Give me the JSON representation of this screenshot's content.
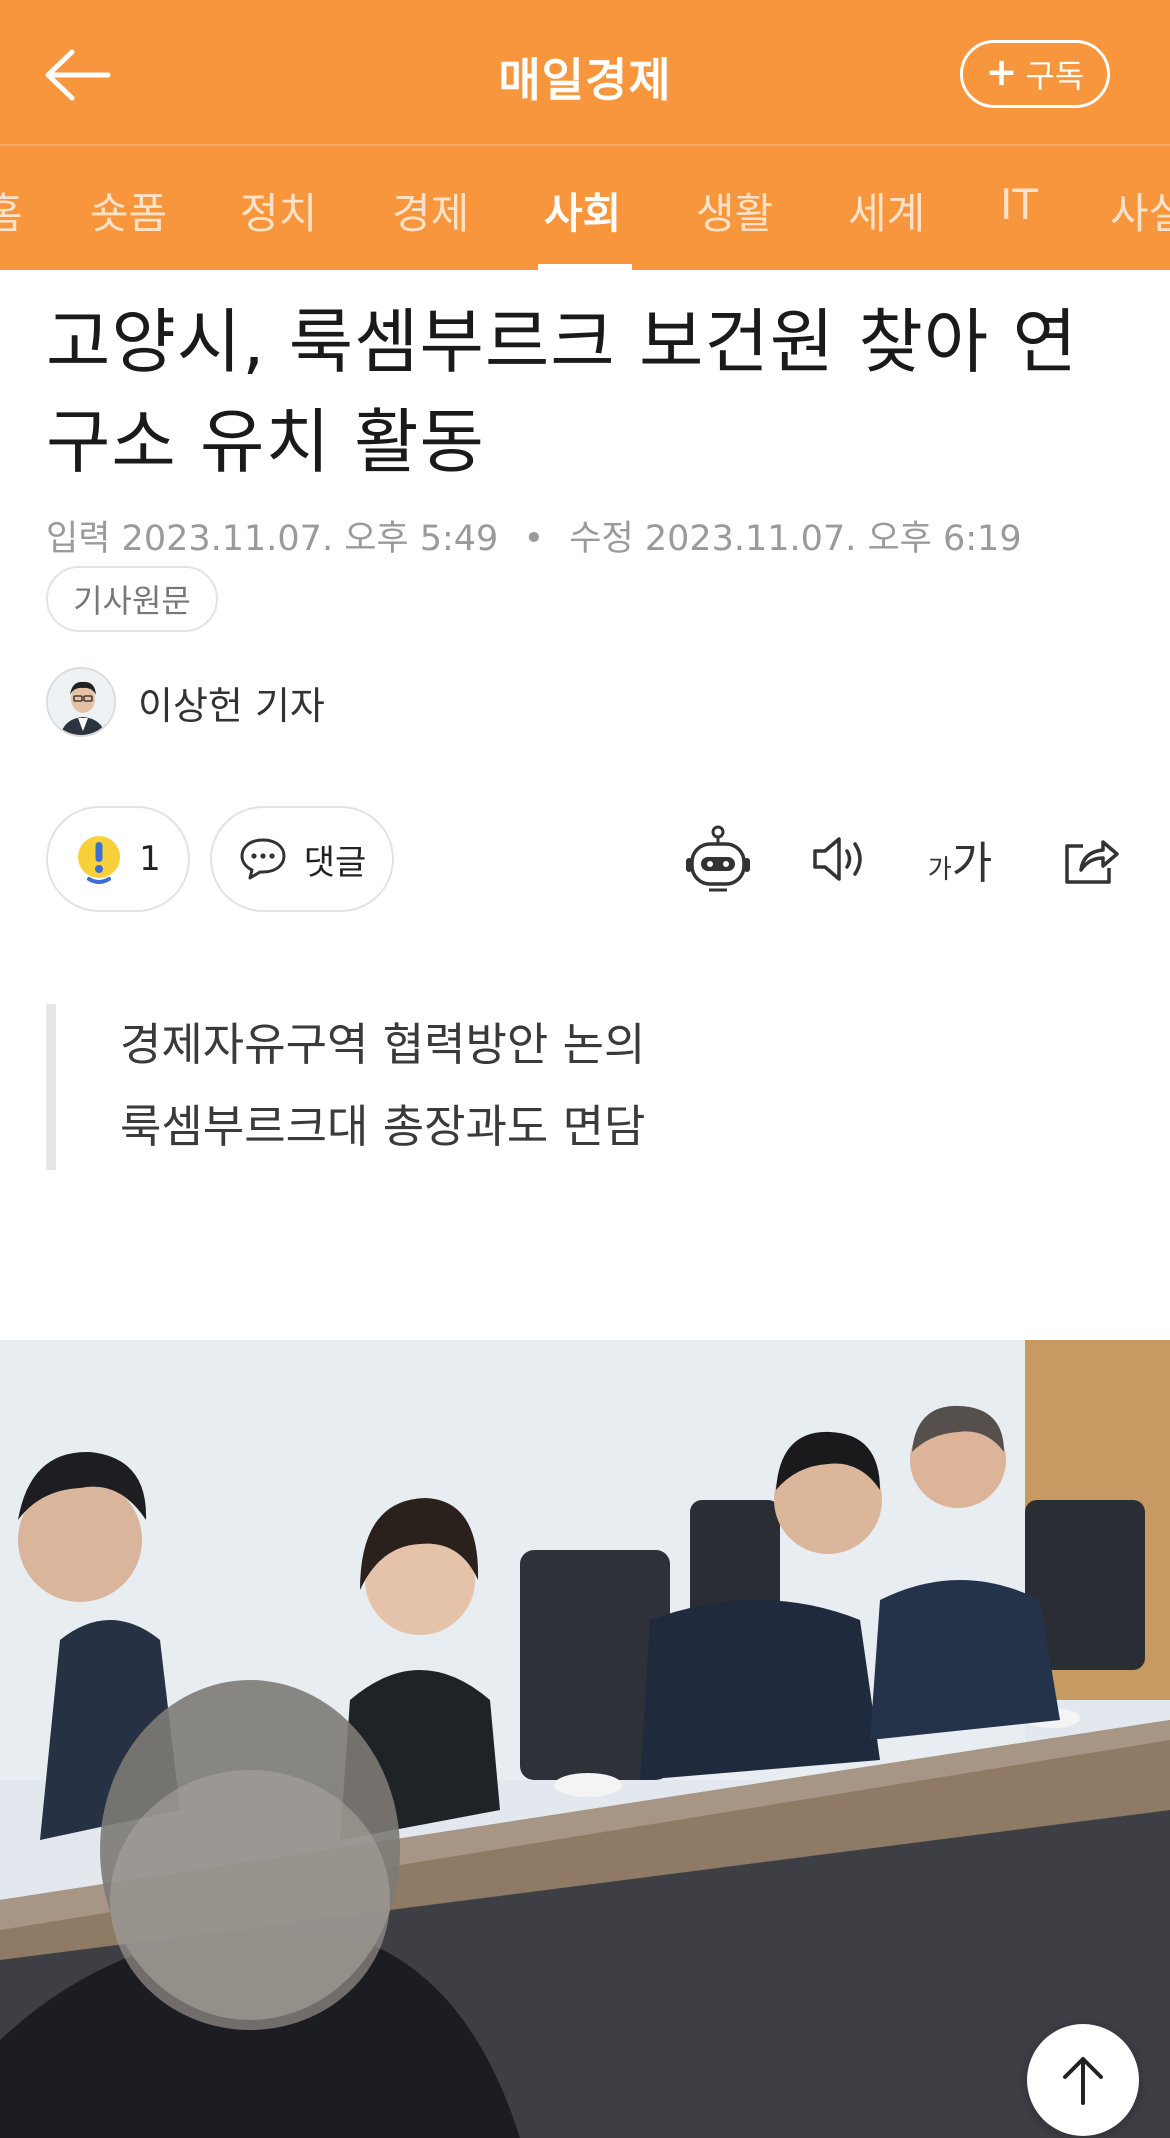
{
  "header": {
    "title": "매일경제",
    "subscribe_label": "구독"
  },
  "tabs": [
    {
      "label": "홈"
    },
    {
      "label": "숏폼"
    },
    {
      "label": "정치"
    },
    {
      "label": "경제"
    },
    {
      "label": "사회",
      "active": true
    },
    {
      "label": "생활"
    },
    {
      "label": "세계"
    },
    {
      "label": "IT"
    },
    {
      "label": "사설"
    }
  ],
  "article": {
    "headline_line1": "고양시, 룩셈부르크 보건원 찾아 연",
    "headline_line2": "구소 유치 활동",
    "input_label": "입력",
    "input_time": "2023.11.07. 오후 5:49",
    "separator": "•",
    "modified_label": "수정",
    "modified_time": "2023.11.07. 오후 6:19",
    "source_chip": "기사원문",
    "author": "이상헌 기자",
    "reaction_count": "1",
    "comment_label": "댓글",
    "font_size_small": "가",
    "font_size_large": "가",
    "summary": [
      "경제자유구역 협력방안 논의",
      "룩셈부르크대 총장과도 면담"
    ]
  },
  "colors": {
    "brand": "#f7963c",
    "text": "#1a1a1a",
    "meta": "#9a9a9a"
  },
  "icons": {
    "back": "arrow-left-icon",
    "subscribe": "plus-icon",
    "reaction": "exclamation-face-icon",
    "comment": "speech-bubble-icon",
    "summary_bot": "robot-icon",
    "tts": "speaker-icon",
    "font_size": "font-size-icon",
    "share": "share-icon",
    "scroll_top": "arrow-up-icon"
  }
}
